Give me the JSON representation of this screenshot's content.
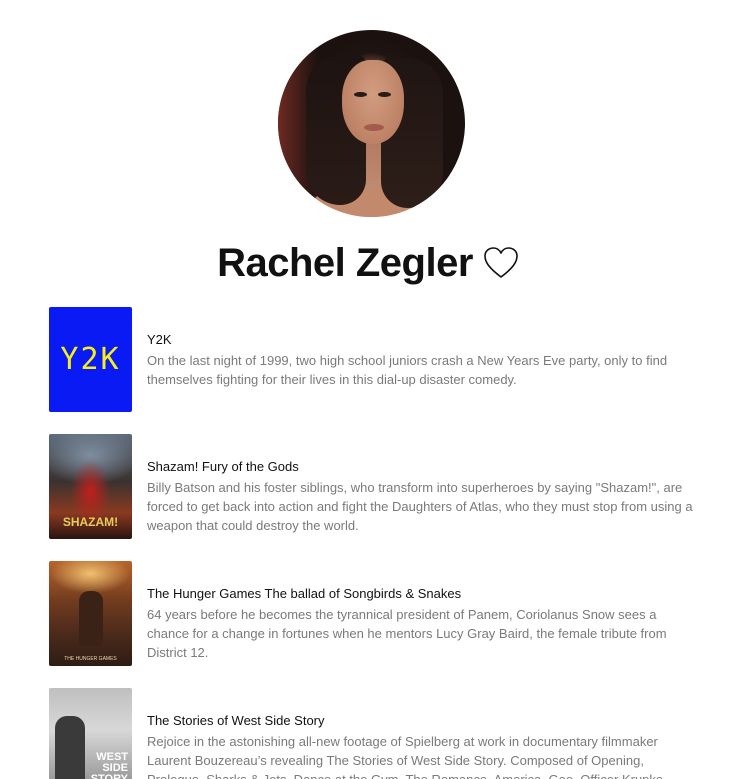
{
  "profile": {
    "name": "Rachel Zegler",
    "avatar_icon": "profile-photo"
  },
  "favorite": {
    "icon": "heart-outline-icon",
    "active": false
  },
  "movies": [
    {
      "title": "Y2K",
      "description": "On the last night of 1999, two high school juniors crash a New Years Eve party, only to find themselves fighting for their lives in this dial-up disaster comedy.",
      "poster_text": "Y2K",
      "poster_color": "#0a1af5",
      "poster_text_color": "#f6ef1a"
    },
    {
      "title": "Shazam! Fury of the Gods",
      "description": "Billy Batson and his foster siblings, who transform into superheroes by saying \"Shazam!\", are forced to get back into action and fight the Daughters of Atlas, who they must stop from using a weapon that could destroy the world.",
      "poster_text": "SHAZAM!"
    },
    {
      "title": "The Hunger Games The ballad of Songbirds & Snakes",
      "description": "64 years before he becomes the tyrannical president of Panem, Coriolanus Snow sees a chance for a change in fortunes when he mentors Lucy Gray Baird, the female tribute from District 12.",
      "poster_text": "THE HUNGER GAMES"
    },
    {
      "title": "The Stories of West Side Story",
      "description": "Rejoice in the astonishing all-new footage of Spielberg at work in documentary filmmaker Laurent Bouzereau’s revealing The Stories of West Side Story. Composed of Opening, Prologue, Sharks & Jets, Dance at the Gym, The Romance, America, Gee, Officer Krupke, Cool, From Quintet to the Rumble, I Feel Pretty, Somewhere, Finale, and Tribute.",
      "poster_text": "WEST SIDE STORY"
    }
  ]
}
